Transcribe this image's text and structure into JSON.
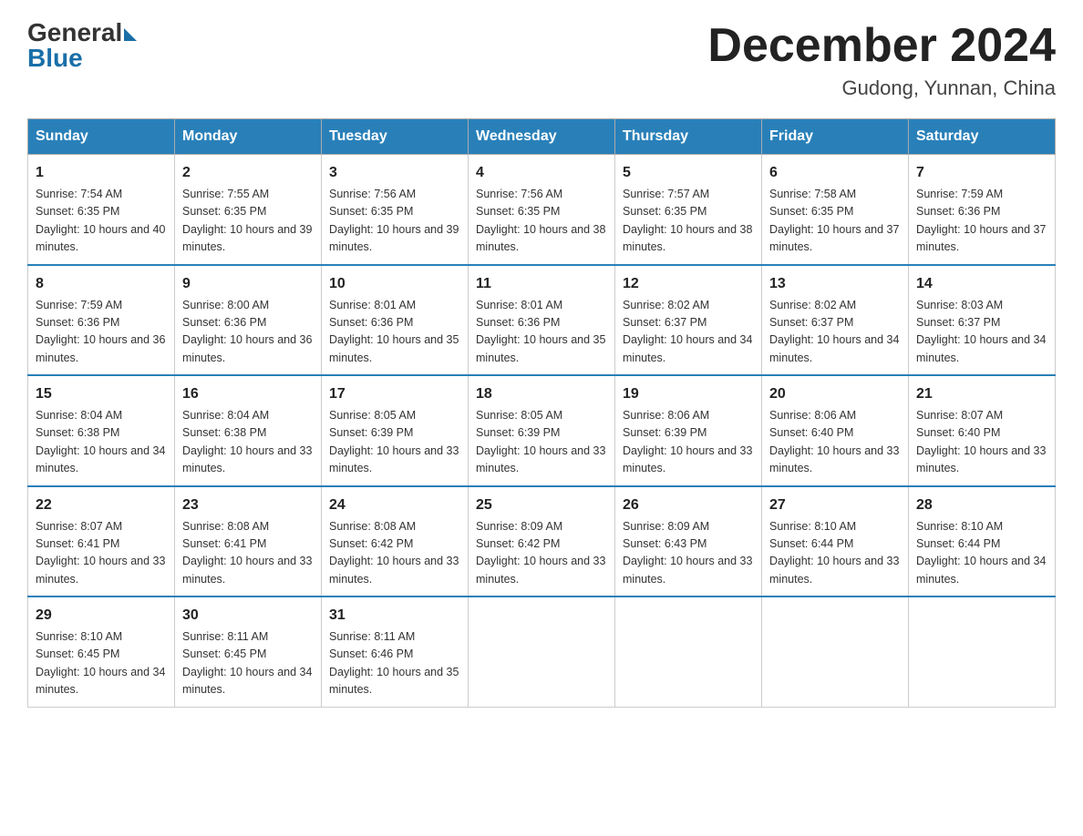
{
  "header": {
    "logo_general": "General",
    "logo_blue": "Blue",
    "month_title": "December 2024",
    "location": "Gudong, Yunnan, China"
  },
  "days_of_week": [
    "Sunday",
    "Monday",
    "Tuesday",
    "Wednesday",
    "Thursday",
    "Friday",
    "Saturday"
  ],
  "weeks": [
    [
      {
        "day": "1",
        "sunrise": "7:54 AM",
        "sunset": "6:35 PM",
        "daylight": "10 hours and 40 minutes."
      },
      {
        "day": "2",
        "sunrise": "7:55 AM",
        "sunset": "6:35 PM",
        "daylight": "10 hours and 39 minutes."
      },
      {
        "day": "3",
        "sunrise": "7:56 AM",
        "sunset": "6:35 PM",
        "daylight": "10 hours and 39 minutes."
      },
      {
        "day": "4",
        "sunrise": "7:56 AM",
        "sunset": "6:35 PM",
        "daylight": "10 hours and 38 minutes."
      },
      {
        "day": "5",
        "sunrise": "7:57 AM",
        "sunset": "6:35 PM",
        "daylight": "10 hours and 38 minutes."
      },
      {
        "day": "6",
        "sunrise": "7:58 AM",
        "sunset": "6:35 PM",
        "daylight": "10 hours and 37 minutes."
      },
      {
        "day": "7",
        "sunrise": "7:59 AM",
        "sunset": "6:36 PM",
        "daylight": "10 hours and 37 minutes."
      }
    ],
    [
      {
        "day": "8",
        "sunrise": "7:59 AM",
        "sunset": "6:36 PM",
        "daylight": "10 hours and 36 minutes."
      },
      {
        "day": "9",
        "sunrise": "8:00 AM",
        "sunset": "6:36 PM",
        "daylight": "10 hours and 36 minutes."
      },
      {
        "day": "10",
        "sunrise": "8:01 AM",
        "sunset": "6:36 PM",
        "daylight": "10 hours and 35 minutes."
      },
      {
        "day": "11",
        "sunrise": "8:01 AM",
        "sunset": "6:36 PM",
        "daylight": "10 hours and 35 minutes."
      },
      {
        "day": "12",
        "sunrise": "8:02 AM",
        "sunset": "6:37 PM",
        "daylight": "10 hours and 34 minutes."
      },
      {
        "day": "13",
        "sunrise": "8:02 AM",
        "sunset": "6:37 PM",
        "daylight": "10 hours and 34 minutes."
      },
      {
        "day": "14",
        "sunrise": "8:03 AM",
        "sunset": "6:37 PM",
        "daylight": "10 hours and 34 minutes."
      }
    ],
    [
      {
        "day": "15",
        "sunrise": "8:04 AM",
        "sunset": "6:38 PM",
        "daylight": "10 hours and 34 minutes."
      },
      {
        "day": "16",
        "sunrise": "8:04 AM",
        "sunset": "6:38 PM",
        "daylight": "10 hours and 33 minutes."
      },
      {
        "day": "17",
        "sunrise": "8:05 AM",
        "sunset": "6:39 PM",
        "daylight": "10 hours and 33 minutes."
      },
      {
        "day": "18",
        "sunrise": "8:05 AM",
        "sunset": "6:39 PM",
        "daylight": "10 hours and 33 minutes."
      },
      {
        "day": "19",
        "sunrise": "8:06 AM",
        "sunset": "6:39 PM",
        "daylight": "10 hours and 33 minutes."
      },
      {
        "day": "20",
        "sunrise": "8:06 AM",
        "sunset": "6:40 PM",
        "daylight": "10 hours and 33 minutes."
      },
      {
        "day": "21",
        "sunrise": "8:07 AM",
        "sunset": "6:40 PM",
        "daylight": "10 hours and 33 minutes."
      }
    ],
    [
      {
        "day": "22",
        "sunrise": "8:07 AM",
        "sunset": "6:41 PM",
        "daylight": "10 hours and 33 minutes."
      },
      {
        "day": "23",
        "sunrise": "8:08 AM",
        "sunset": "6:41 PM",
        "daylight": "10 hours and 33 minutes."
      },
      {
        "day": "24",
        "sunrise": "8:08 AM",
        "sunset": "6:42 PM",
        "daylight": "10 hours and 33 minutes."
      },
      {
        "day": "25",
        "sunrise": "8:09 AM",
        "sunset": "6:42 PM",
        "daylight": "10 hours and 33 minutes."
      },
      {
        "day": "26",
        "sunrise": "8:09 AM",
        "sunset": "6:43 PM",
        "daylight": "10 hours and 33 minutes."
      },
      {
        "day": "27",
        "sunrise": "8:10 AM",
        "sunset": "6:44 PM",
        "daylight": "10 hours and 33 minutes."
      },
      {
        "day": "28",
        "sunrise": "8:10 AM",
        "sunset": "6:44 PM",
        "daylight": "10 hours and 34 minutes."
      }
    ],
    [
      {
        "day": "29",
        "sunrise": "8:10 AM",
        "sunset": "6:45 PM",
        "daylight": "10 hours and 34 minutes."
      },
      {
        "day": "30",
        "sunrise": "8:11 AM",
        "sunset": "6:45 PM",
        "daylight": "10 hours and 34 minutes."
      },
      {
        "day": "31",
        "sunrise": "8:11 AM",
        "sunset": "6:46 PM",
        "daylight": "10 hours and 35 minutes."
      },
      null,
      null,
      null,
      null
    ]
  ]
}
